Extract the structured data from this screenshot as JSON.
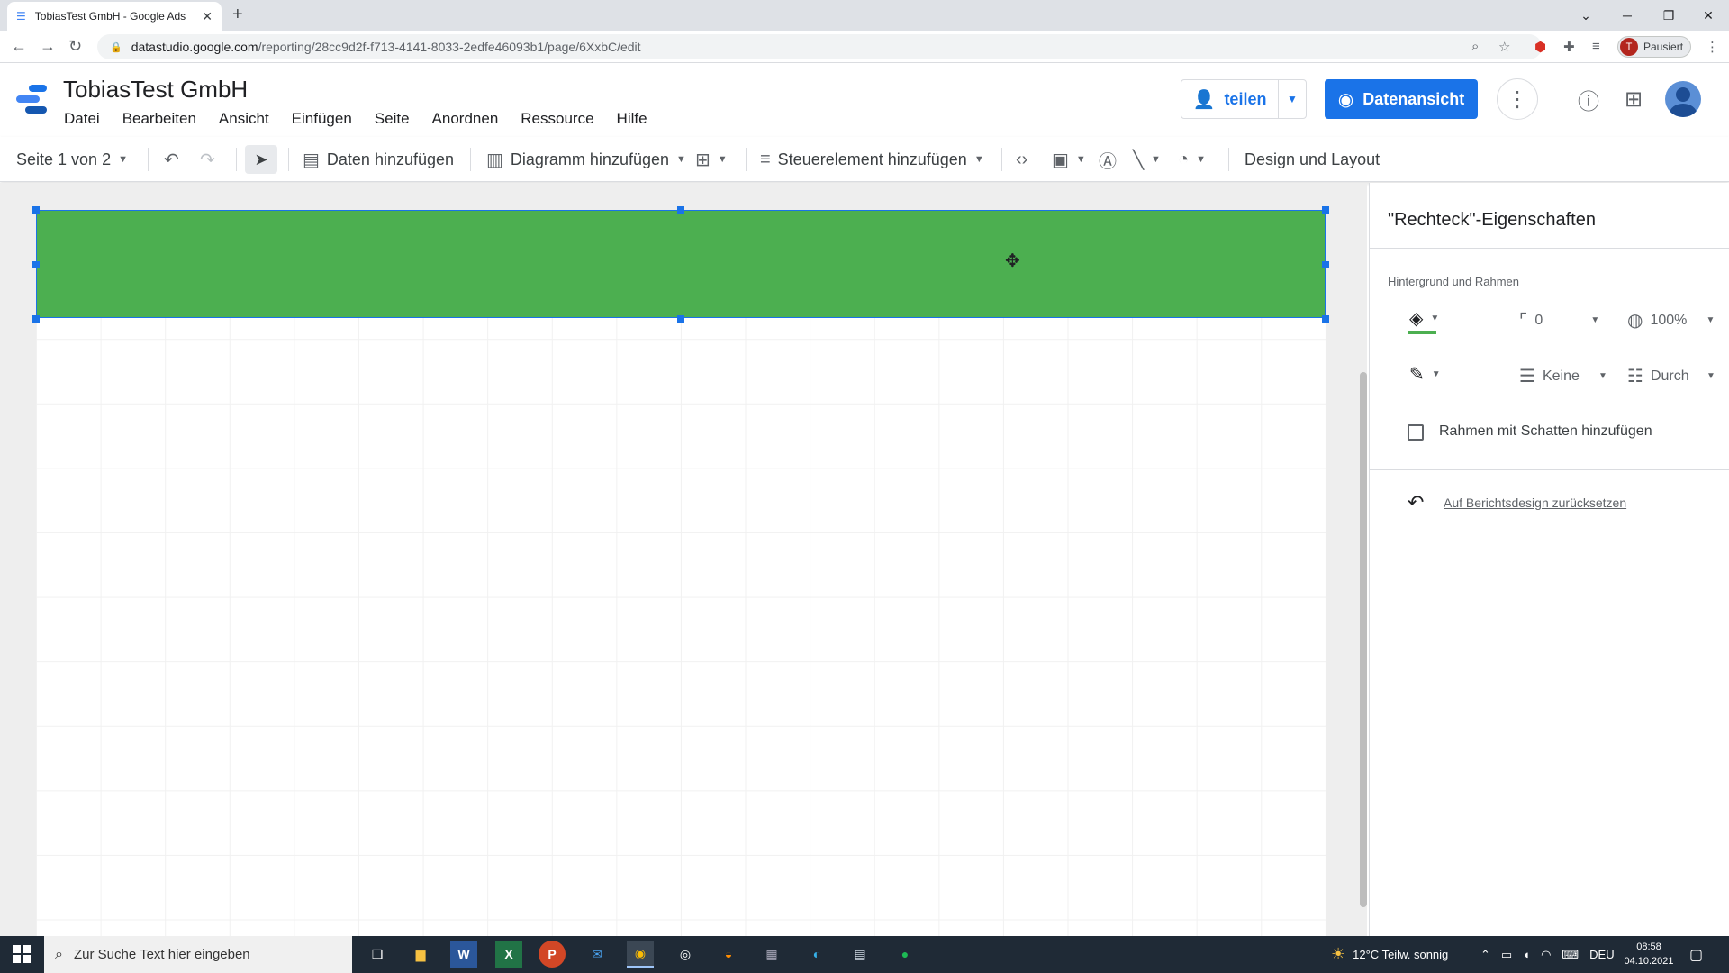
{
  "browser": {
    "tab_title": "TobiasTest GmbH - Google Ads",
    "new_tab": "+",
    "url_host": "datastudio.google.com",
    "url_path": "/reporting/28cc9d2f-f713-4141-8033-2edfe46093b1/page/6XxbC/edit",
    "profile_initial": "T",
    "profile_status": "Pausiert"
  },
  "app": {
    "title": "TobiasTest GmbH",
    "menu": [
      "Datei",
      "Bearbeiten",
      "Ansicht",
      "Einfügen",
      "Seite",
      "Anordnen",
      "Ressource",
      "Hilfe"
    ],
    "share_label": "teilen",
    "view_label": "Datenansicht"
  },
  "toolbar": {
    "page_selector": "Seite 1 von 2",
    "add_data": "Daten hinzufügen",
    "add_chart": "Diagramm hinzufügen",
    "add_control": "Steuerelement hinzufügen",
    "theme_layout": "Design und Layout"
  },
  "panel": {
    "title": "\"Rechteck\"-Eigenschaften",
    "section": "Hintergrund und Rahmen",
    "border_radius": "0",
    "opacity": "100%",
    "border_weight": "Keine",
    "border_style": "Durch",
    "shadow_label": "Rahmen mit Schatten hinzufügen",
    "reset_label": "Auf Berichtsdesign zurücksetzen"
  },
  "taskbar": {
    "search_placeholder": "Zur Suche Text hier eingeben",
    "weather": "12°C  Teilw. sonnig",
    "language": "DEU",
    "time": "08:58",
    "date": "04.10.2021"
  },
  "colors": {
    "accent": "#1a73e8",
    "rect_fill": "#4caf50"
  }
}
